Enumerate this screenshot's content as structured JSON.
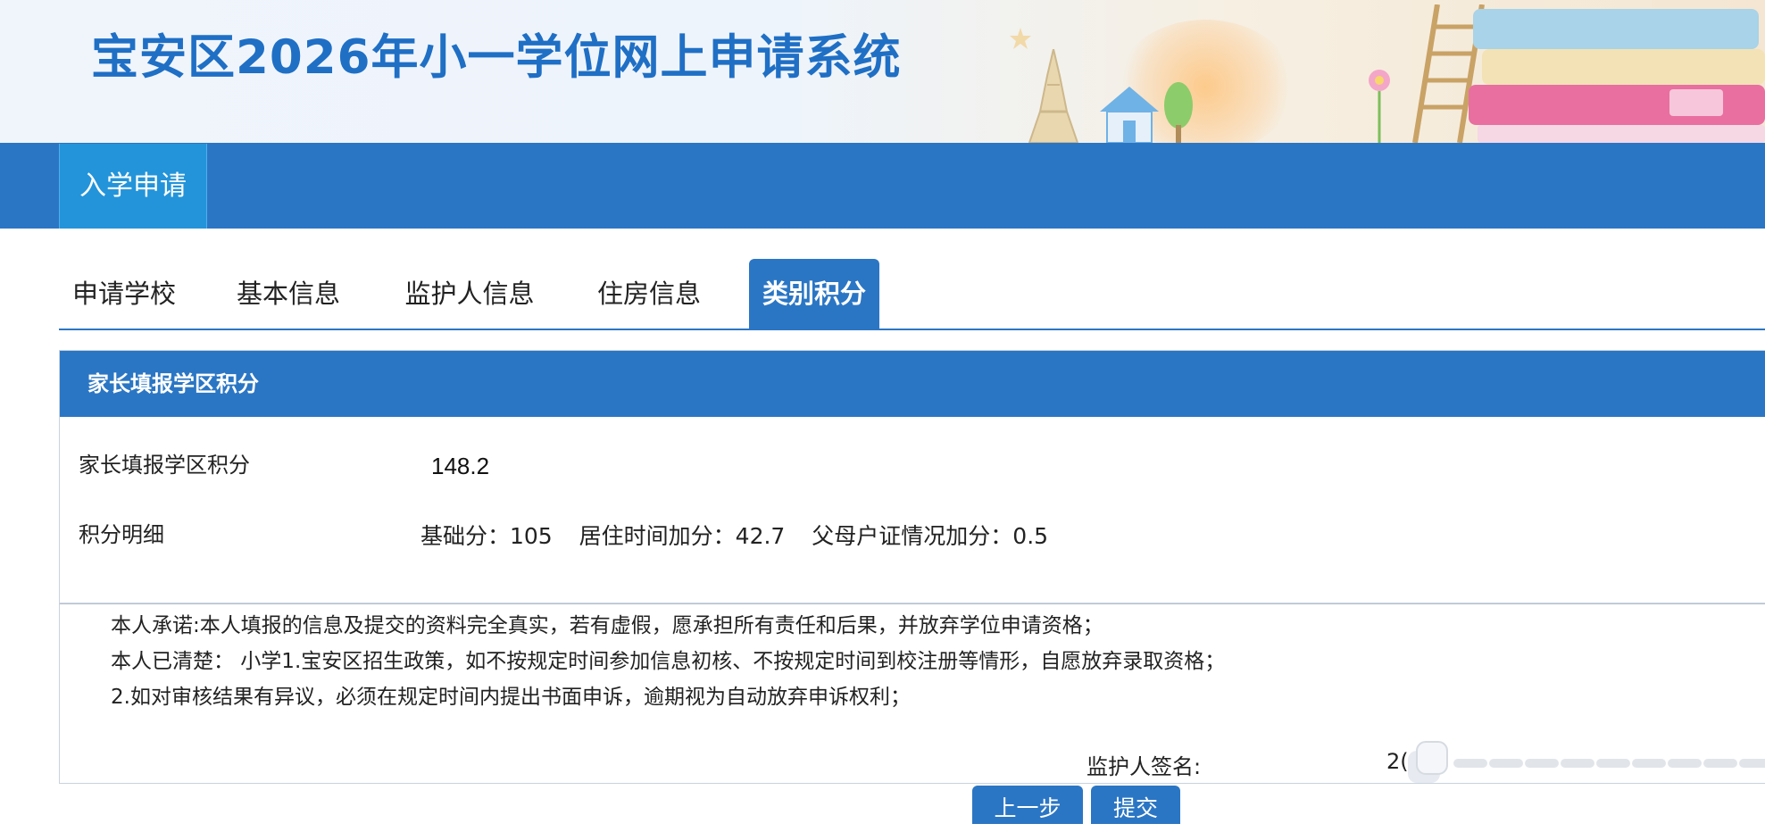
{
  "header": {
    "title": "宝安区2026年小一学位网上申请系统"
  },
  "nav": {
    "active_tab": "入学申请"
  },
  "steps": [
    {
      "label": "申请学校",
      "active": false
    },
    {
      "label": "基本信息",
      "active": false
    },
    {
      "label": "监护人信息",
      "active": false
    },
    {
      "label": "住房信息",
      "active": false
    },
    {
      "label": "类别积分",
      "active": true
    }
  ],
  "panel": {
    "header": "家长填报学区积分",
    "score_label": "家长填报学区积分",
    "score_value": "148.2",
    "detail_label": "积分明细",
    "detail": {
      "base": "基础分：105",
      "residence": "居住时间加分：42.7",
      "hukou": "父母户证情况加分：0.5"
    }
  },
  "commitment": {
    "lines": [
      "本人承诺:本人填报的信息及提交的资料完全真实，若有虚假，愿承担所有责任和后果，并放弃学位申请资格；",
      "本人已清楚： 小学1.宝安区招生政策，如不按规定时间参加信息初核、不按规定时间到校注册等情形，自愿放弃录取资格；",
      "2.如对审核结果有异议，必须在规定时间内提出书面申诉，逾期视为自动放弃申诉权利；"
    ],
    "signature_label": "监护人签名:",
    "signature_value": "2("
  },
  "buttons": {
    "prev": "上一步",
    "submit": "提交"
  },
  "colors": {
    "primary_blue": "#2b76c4",
    "nav_tab_blue": "#2394da",
    "title_blue": "#1f6fc5"
  }
}
